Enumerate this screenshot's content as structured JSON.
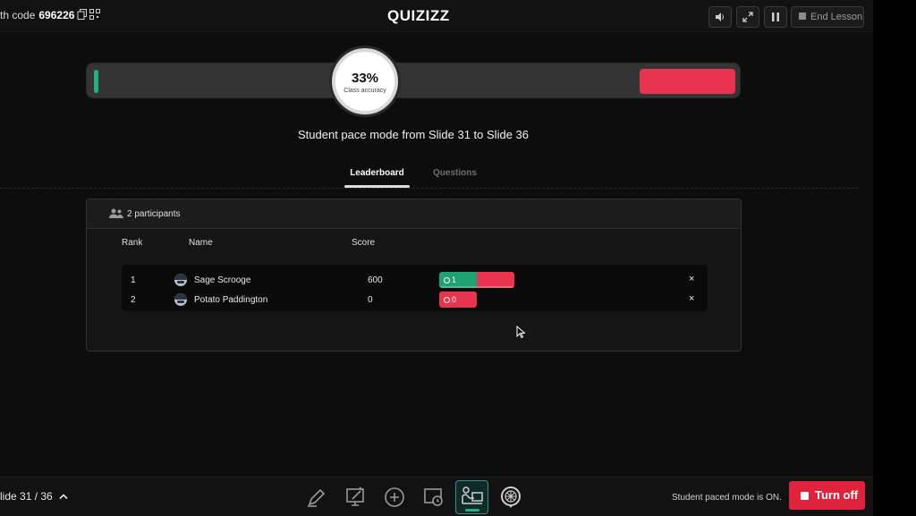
{
  "topbar": {
    "join_code_label": "th code",
    "join_code": "696226",
    "logo": "QUIZIZZ",
    "end_lesson_label": "End Lesson",
    "icons": [
      "copy-icon",
      "qr-code-icon",
      "volume-icon",
      "fullscreen-icon",
      "pause-icon",
      "stop-icon"
    ]
  },
  "accuracy": {
    "percent_text": "33%",
    "label": "Class accuracy",
    "correct_fraction": 0.01,
    "incorrect_fraction": 0.15,
    "colors": {
      "correct": "#1fb17e",
      "incorrect": "#e8344e"
    }
  },
  "pace_text": "Student pace mode from Slide 31 to Slide 36",
  "tabs": [
    {
      "label": "Leaderboard",
      "active": true
    },
    {
      "label": "Questions",
      "active": false
    }
  ],
  "leaderboard": {
    "participants": "2 participants",
    "columns": {
      "rank": "Rank",
      "name": "Name",
      "score": "Score"
    },
    "rows": [
      {
        "rank": "1",
        "name": "Sage Scrooge",
        "score": "600",
        "streak": "1",
        "correct": 1,
        "incorrect": 1
      },
      {
        "rank": "2",
        "name": "Potato Paddington",
        "score": "0",
        "streak": "0",
        "correct": 0,
        "incorrect": 1
      }
    ],
    "remove_symbol": "×"
  },
  "bottombar": {
    "slide_indicator": "lide 31 / 36",
    "tools": [
      "pen-icon",
      "annotate-icon",
      "add-icon",
      "timer-icon",
      "student-pace-icon",
      "spinner-wheel-icon"
    ],
    "status": "Student paced mode is ON.",
    "turn_off_label": "Turn off"
  }
}
